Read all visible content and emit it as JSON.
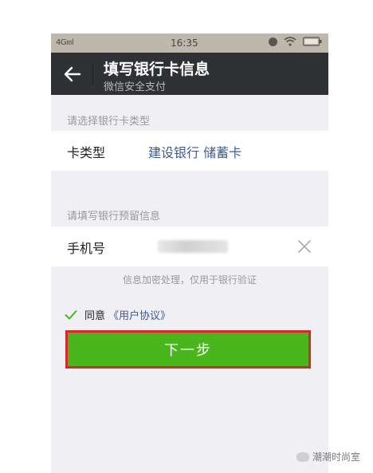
{
  "status_bar": {
    "signal": "4Gıııl",
    "time": "16:35"
  },
  "header": {
    "title": "填写银行卡信息",
    "subtitle": "微信安全支付"
  },
  "card_section": {
    "label": "请选择银行卡类型",
    "field_label": "卡类型",
    "field_value": "建设银行 储蓄卡"
  },
  "phone_section": {
    "label": "请填写银行预留信息",
    "field_label": "手机号",
    "field_value": ""
  },
  "hint": "信息加密处理，仅用于银行验证",
  "agreement": {
    "checked": true,
    "label": "同意",
    "link": "《用户协议》"
  },
  "next_button": "下一步",
  "watermark": "潮潮时尚室",
  "colors": {
    "accent_green": "#4ab61d",
    "highlight_border": "#d8262a",
    "link_blue": "#3d5b8c",
    "header_bg": "#2f3134"
  },
  "icons": {
    "back": "arrow-left-icon",
    "clear": "close-icon",
    "check": "checkmark-icon",
    "wifi": "wifi-icon",
    "battery": "battery-icon",
    "alarm": "alarm-icon"
  }
}
